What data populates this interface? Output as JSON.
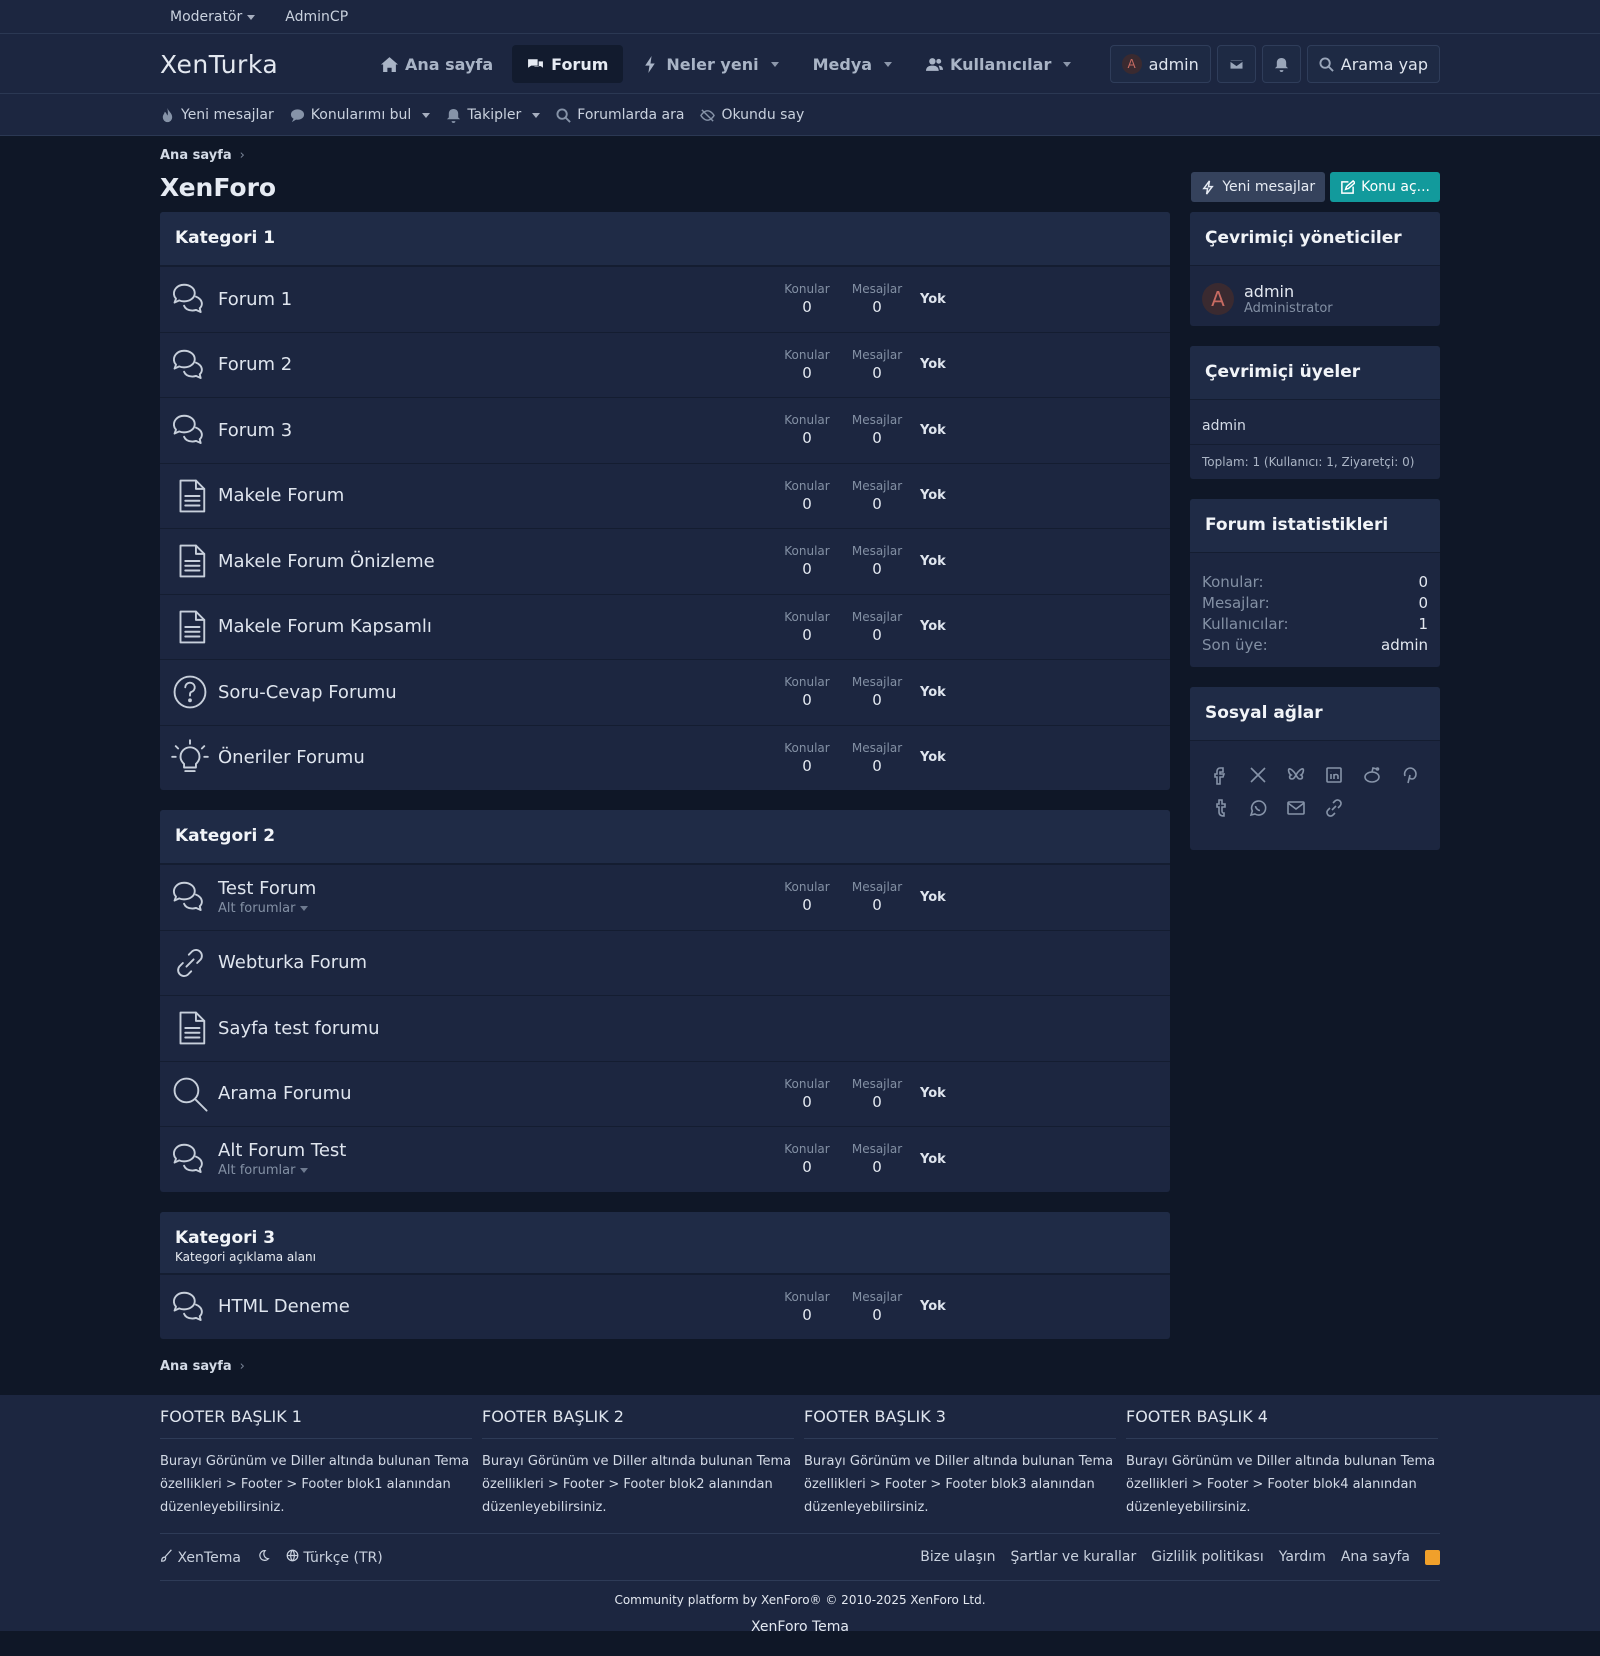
{
  "topbar": {
    "moderator": "Moderatör",
    "admincp": "AdminCP"
  },
  "header": {
    "logo": "XenTurka",
    "nav": [
      {
        "label": "Ana sayfa",
        "icon": "home-icon"
      },
      {
        "label": "Forum",
        "icon": "comments-icon"
      },
      {
        "label": "Neler yeni",
        "icon": "bolt-icon"
      },
      {
        "label": "Medya",
        "icon": ""
      },
      {
        "label": "Kullanıcılar",
        "icon": "users-icon"
      }
    ],
    "user": "admin",
    "user_initial": "A",
    "search": "Arama yap"
  },
  "subnav": [
    "Yeni mesajlar",
    "Konularımı bul",
    "Takipler",
    "Forumlarda ara",
    "Okundu say"
  ],
  "breadcrumb": "Ana sayfa",
  "page_title": "XenForo",
  "buttons": {
    "new_posts": "Yeni mesajlar",
    "new_thread": "Konu aç..."
  },
  "labels": {
    "threads": "Konular",
    "messages": "Mesajlar",
    "none": "Yok",
    "subforums": "Alt forumlar"
  },
  "categories": [
    {
      "title": "Kategori 1",
      "desc": "",
      "forums": [
        {
          "name": "Forum 1",
          "icon": "comments-icon",
          "threads": "0",
          "messages": "0",
          "last": "Yok"
        },
        {
          "name": "Forum 2",
          "icon": "comments-icon",
          "threads": "0",
          "messages": "0",
          "last": "Yok"
        },
        {
          "name": "Forum 3",
          "icon": "comments-icon",
          "threads": "0",
          "messages": "0",
          "last": "Yok"
        },
        {
          "name": "Makele Forum",
          "icon": "document-icon",
          "threads": "0",
          "messages": "0",
          "last": "Yok"
        },
        {
          "name": "Makele Forum Önizleme",
          "icon": "document-icon",
          "threads": "0",
          "messages": "0",
          "last": "Yok"
        },
        {
          "name": "Makele Forum Kapsamlı",
          "icon": "document-icon",
          "threads": "0",
          "messages": "0",
          "last": "Yok"
        },
        {
          "name": "Soru-Cevap Forumu",
          "icon": "question-icon",
          "threads": "0",
          "messages": "0",
          "last": "Yok"
        },
        {
          "name": "Öneriler Forumu",
          "icon": "lightbulb-icon",
          "threads": "0",
          "messages": "0",
          "last": "Yok"
        }
      ]
    },
    {
      "title": "Kategori 2",
      "desc": "",
      "forums": [
        {
          "name": "Test Forum",
          "icon": "comments-icon",
          "sub": "Alt forumlar",
          "threads": "0",
          "messages": "0",
          "last": "Yok"
        },
        {
          "name": "Webturka Forum",
          "icon": "link-icon"
        },
        {
          "name": "Sayfa test forumu",
          "icon": "document-icon"
        },
        {
          "name": "Arama Forumu",
          "icon": "search-icon",
          "threads": "0",
          "messages": "0",
          "last": "Yok"
        },
        {
          "name": "Alt Forum Test",
          "icon": "comments-icon",
          "sub": "Alt forumlar",
          "threads": "0",
          "messages": "0",
          "last": "Yok"
        }
      ]
    },
    {
      "title": "Kategori 3",
      "desc": "Kategori açıklama alanı",
      "forums": [
        {
          "name": "HTML Deneme",
          "icon": "comments-icon",
          "threads": "0",
          "messages": "0",
          "last": "Yok"
        }
      ]
    }
  ],
  "sidebar": {
    "staff_title": "Çevrimiçi yöneticiler",
    "staff_name": "admin",
    "staff_role": "Administrator",
    "staff_initial": "A",
    "online_title": "Çevrimiçi üyeler",
    "online_list": "admin",
    "online_total": "Toplam: 1 (Kullanıcı: 1, Ziyaretçi: 0)",
    "stats_title": "Forum istatistikleri",
    "stats": [
      {
        "k": "Konular:",
        "v": "0"
      },
      {
        "k": "Mesajlar:",
        "v": "0"
      },
      {
        "k": "Kullanıcılar:",
        "v": "1"
      },
      {
        "k": "Son üye:",
        "v": "admin"
      }
    ],
    "social_title": "Sosyal ağlar",
    "social": [
      "facebook-icon",
      "x-icon",
      "bluesky-icon",
      "linkedin-icon",
      "reddit-icon",
      "pinterest-icon",
      "tumblr-icon",
      "whatsapp-icon",
      "email-icon",
      "link-icon"
    ]
  },
  "footer": {
    "cols": [
      {
        "h": "FOOTER BAŞLIK 1",
        "p": "Burayı Görünüm ve Diller altında bulunan Tema özellikleri > Footer > Footer blok1 alanından düzenleyebilirsiniz."
      },
      {
        "h": "FOOTER BAŞLIK 2",
        "p": "Burayı Görünüm ve Diller altında bulunan Tema özellikleri > Footer > Footer blok2 alanından düzenleyebilirsiniz."
      },
      {
        "h": "FOOTER BAŞLIK 3",
        "p": "Burayı Görünüm ve Diller altında bulunan Tema özellikleri > Footer > Footer blok3 alanından düzenleyebilirsiniz."
      },
      {
        "h": "FOOTER BAŞLIK 4",
        "p": "Burayı Görünüm ve Diller altında bulunan Tema özellikleri > Footer > Footer blok4 alanından düzenleyebilirsiniz."
      }
    ],
    "theme": "XenTema",
    "language": "Türkçe (TR)",
    "links": [
      "Bize ulaşın",
      "Şartlar ve kurallar",
      "Gizlilik politikası",
      "Yardım",
      "Ana sayfa"
    ],
    "copyright": "Community platform by XenForo® © 2010-2025 XenForo Ltd.",
    "credit": "XenForo Tema"
  }
}
